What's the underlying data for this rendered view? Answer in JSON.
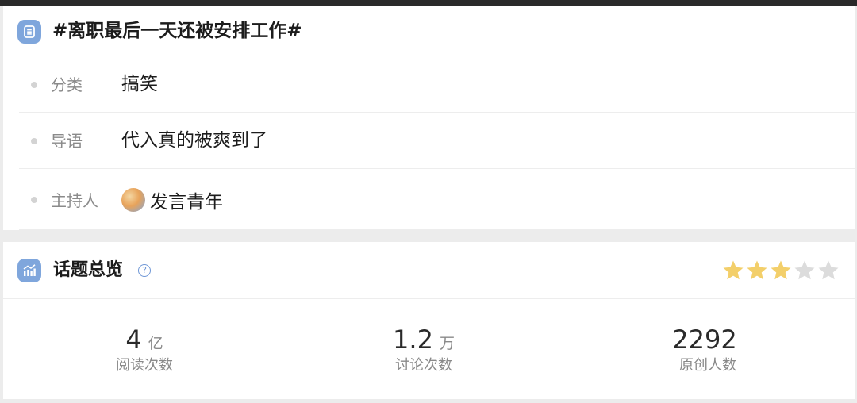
{
  "topic": {
    "title": "#离职最后一天还被安排工作#",
    "rows": [
      {
        "label": "分类",
        "value": "搞笑"
      },
      {
        "label": "导语",
        "value": "代入真的被爽到了"
      },
      {
        "label": "主持人",
        "value": "发言青年"
      }
    ]
  },
  "overview": {
    "title": "话题总览",
    "help_icon": "question-circle-icon",
    "rating": {
      "score": 3,
      "max": 5,
      "filled_color": "#f3cf6a",
      "empty_color": "#dcdcdc"
    },
    "stats": [
      {
        "value": "4",
        "unit": "亿",
        "label": "阅读次数"
      },
      {
        "value": "1.2",
        "unit": "万",
        "label": "讨论次数"
      },
      {
        "value": "2292",
        "unit": "",
        "label": "原创人数"
      }
    ]
  },
  "colors": {
    "accent": "#7fa6dc",
    "link": "#6f97d6"
  }
}
